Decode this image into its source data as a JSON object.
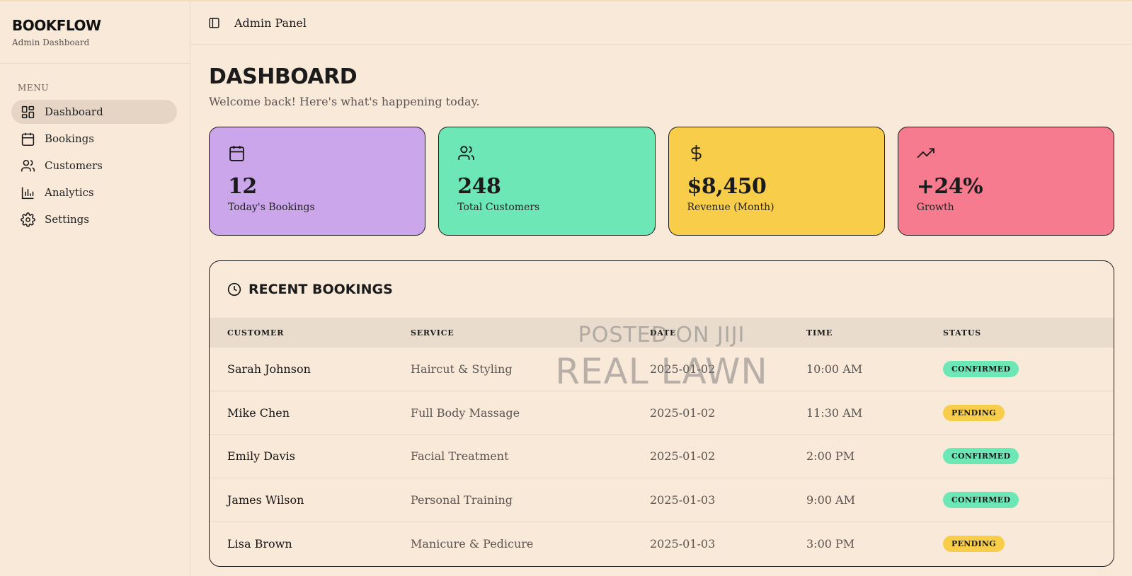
{
  "app": {
    "name": "BOOKFLOW",
    "subtitle": "Admin Dashboard"
  },
  "sidebar": {
    "menu_label": "MENU",
    "items": [
      {
        "label": "Dashboard",
        "icon": "dashboard-icon",
        "active": true
      },
      {
        "label": "Bookings",
        "icon": "calendar-icon"
      },
      {
        "label": "Customers",
        "icon": "users-icon"
      },
      {
        "label": "Analytics",
        "icon": "bar-chart-icon"
      },
      {
        "label": "Settings",
        "icon": "gear-icon"
      }
    ]
  },
  "header": {
    "title": "Admin Panel",
    "toggle_icon": "sidebar-toggle-icon"
  },
  "page": {
    "title": "DASHBOARD",
    "subtitle": "Welcome back! Here's what's happening today."
  },
  "stats": [
    {
      "value": "12",
      "label": "Today's Bookings",
      "icon": "calendar-icon",
      "color": "#cba6eb"
    },
    {
      "value": "248",
      "label": "Total Customers",
      "icon": "users-icon",
      "color": "#6ee7b7"
    },
    {
      "value": "$8,450",
      "label": "Revenue (Month)",
      "icon": "dollar-icon",
      "color": "#f7cd4a"
    },
    {
      "value": "+24%",
      "label": "Growth",
      "icon": "trending-up-icon",
      "color": "#f77b8f"
    }
  ],
  "recent_bookings": {
    "title": "RECENT BOOKINGS",
    "icon": "clock-icon",
    "columns": [
      "CUSTOMER",
      "SERVICE",
      "DATE",
      "TIME",
      "STATUS"
    ],
    "rows": [
      {
        "customer": "Sarah Johnson",
        "service": "Haircut & Styling",
        "date": "2025-01-02",
        "time": "10:00 AM",
        "status": "CONFIRMED"
      },
      {
        "customer": "Mike Chen",
        "service": "Full Body Massage",
        "date": "2025-01-02",
        "time": "11:30 AM",
        "status": "PENDING"
      },
      {
        "customer": "Emily Davis",
        "service": "Facial Treatment",
        "date": "2025-01-02",
        "time": "2:00 PM",
        "status": "CONFIRMED"
      },
      {
        "customer": "James Wilson",
        "service": "Personal Training",
        "date": "2025-01-03",
        "time": "9:00 AM",
        "status": "CONFIRMED"
      },
      {
        "customer": "Lisa Brown",
        "service": "Manicure & Pedicure",
        "date": "2025-01-03",
        "time": "3:00 PM",
        "status": "PENDING"
      }
    ]
  },
  "status_colors": {
    "CONFIRMED": "#6ee7b7",
    "PENDING": "#f7cd4a"
  },
  "watermark": {
    "line1": "POSTED ON JIJI",
    "line2": "REAL LAWN"
  }
}
